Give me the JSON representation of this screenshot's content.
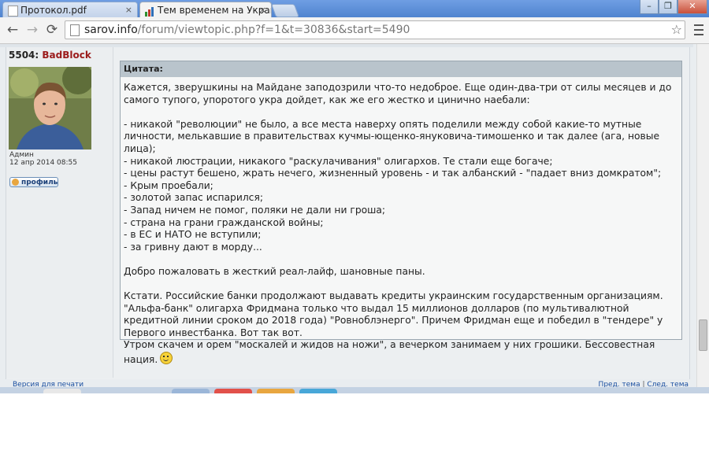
{
  "browser": {
    "tabs": [
      {
        "title": "Протокол.pdf",
        "close": "×",
        "active": false
      },
      {
        "title": "Тем временем на Украи",
        "close": "×",
        "active": true
      }
    ],
    "window_buttons": [
      "–",
      "❐",
      "✕"
    ],
    "url_host": "sarov.info",
    "url_path": "/forum/viewtopic.php?f=1&t=30836&start=5490",
    "back_icon": "←",
    "forward_icon": "→",
    "reload_icon": "⟳",
    "star_icon": "☆"
  },
  "post": {
    "number": "5504:",
    "author": "BadBlock",
    "rank": "Админ",
    "date": "12 апр 2014 08:55",
    "profile_label": "профиль",
    "quote_label": "Цитата:",
    "quote_lines": [
      "Кажется, зверушкины на Майдане заподозрили что-то недоброе. Еще один-два-три от силы месяцев и до самого тупого, упоротого укра дойдет, как же его жестко и цинично наебали:",
      "",
      "- никакой \"революции\" не было, а все места наверху опять поделили между собой какие-то мутные личности, мелькавшие в правительствах кучмы-ющенко-януковича-тимошенко и так далее (ага, новые лица);",
      "- никакой люстрации, никакого \"раскулачивания\" олигархов. Те стали еще богаче;",
      "- цены растут бешено, жрать нечего, жизненный уровень - и так албанский - \"падает вниз домкратом\";",
      "- Крым проебали;",
      "- золотой запас испарился;",
      "- Запад ничем не помог, поляки не дали ни гроша;",
      "- страна на грани гражданской войны;",
      "- в ЕС и НАТО не вступили;",
      "- за гривну дают в морду...",
      "",
      "Добро пожаловать в жесткий реал-лайф, шановные паны.",
      "",
      "Кстати. Российские банки продолжают выдавать кредиты украинским государственным организациям. \"Альфа-банк\" олигарха Фридмана только что выдал 15 миллионов долларов (по мультивалютной кредитной линии сроком до 2018 года) \"Ровноблэнерго\". Причем Фридман еще и победил в \"тендере\" у Первого инвестбанка. Вот так вот.",
      "Утром скачем и орем \"москалей и жидов на ножи\", а вечерком занимаем у них грошики. Бессовестная нация."
    ]
  },
  "footer": {
    "print_version": "Версия для печати",
    "prev_topic": "Пред. тема",
    "separator": "|",
    "next_topic": "След. тема"
  },
  "colors": {
    "author": "#9b1b1b",
    "link": "#1a4fa0",
    "quote_header": "#b9c4cc"
  }
}
